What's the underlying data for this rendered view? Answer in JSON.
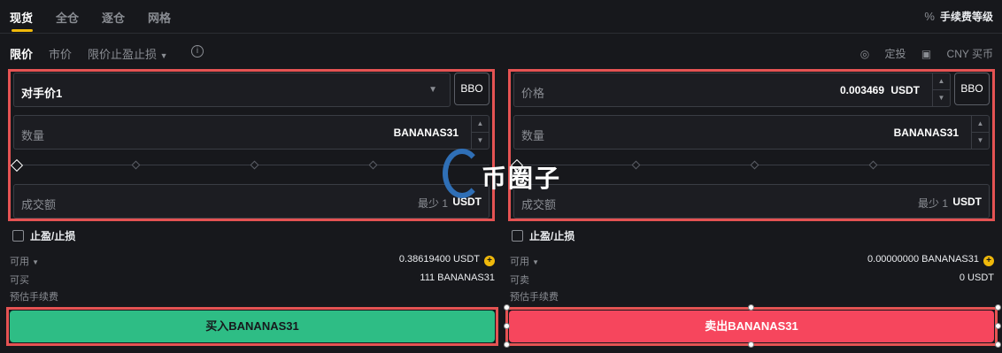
{
  "tabs": [
    "现货",
    "全仓",
    "逐仓",
    "网格"
  ],
  "fee_level": {
    "icon": "%",
    "label": "手续费等级"
  },
  "order_types": [
    "限价",
    "市价",
    "限价止盈止损"
  ],
  "order_type_arrow": "▼",
  "info_icon": "i",
  "right_links": {
    "auto_invest": "定投",
    "buy_cny": "CNY 买币"
  },
  "buy": {
    "price_field_label": "对手价1",
    "bbo": "BBO",
    "qty_label": "数量",
    "qty_unit": "BANANAS31",
    "amount_label": "成交额",
    "amount_min": "最少 1",
    "amount_unit": "USDT",
    "tpsl": "止盈/止损",
    "available_label": "可用",
    "available_value": "0.38619400 USDT",
    "can_buy_label": "可买",
    "can_buy_value": "111 BANANAS31",
    "fee_label": "预估手续费",
    "button": "买入BANANAS31"
  },
  "sell": {
    "price_label": "价格",
    "price_value": "0.003469",
    "price_unit": "USDT",
    "bbo": "BBO",
    "qty_label": "数量",
    "qty_unit": "BANANAS31",
    "amount_label": "成交额",
    "amount_min": "最少 1",
    "amount_unit": "USDT",
    "tpsl": "止盈/止损",
    "available_label": "可用",
    "available_value": "0.00000000 BANANAS31",
    "can_sell_label": "可卖",
    "can_sell_value": "0 USDT",
    "fee_label": "预估手续费",
    "button": "卖出BANANAS31"
  },
  "watermark": "币圈子",
  "colors": {
    "accent": "#f0b90b",
    "buy": "#2ebd85",
    "sell": "#f6465d",
    "highlight": "#e55353"
  }
}
